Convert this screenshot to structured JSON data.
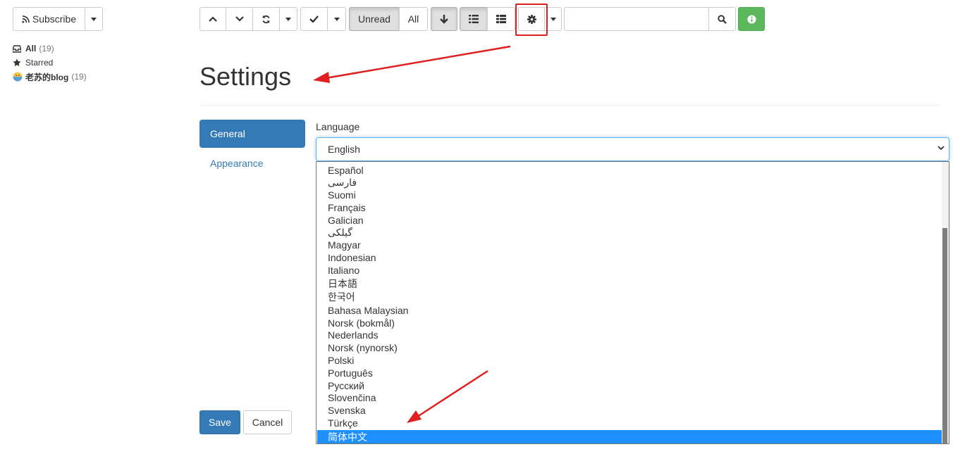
{
  "toolbar": {
    "subscribe_label": "Subscribe",
    "unread_label": "Unread",
    "all_label": "All",
    "search_value": "",
    "search_placeholder": ""
  },
  "sidebar": {
    "items": [
      {
        "label": "All",
        "count": "(19)",
        "icon": "inbox-icon"
      },
      {
        "label": "Starred",
        "count": "",
        "icon": "star-icon"
      },
      {
        "label": "老苏的blog",
        "count": "(19)",
        "icon": "feed-avatar-icon"
      }
    ]
  },
  "settings": {
    "title": "Settings",
    "nav": {
      "general": "General",
      "appearance": "Appearance"
    },
    "language_label": "Language",
    "language_value": "English",
    "options": [
      "Español",
      "فارسی",
      "Suomi",
      "Français",
      "Galician",
      "گیلکی",
      "Magyar",
      "Indonesian",
      "Italiano",
      "日本語",
      "한국어",
      "Bahasa Malaysian",
      "Norsk (bokmål)",
      "Nederlands",
      "Norsk (nynorsk)",
      "Polski",
      "Português",
      "Русский",
      "Slovenčina",
      "Svenska",
      "Türkçe",
      "简体中文"
    ],
    "selected_option": "简体中文",
    "save_label": "Save",
    "cancel_label": "Cancel"
  },
  "colors": {
    "primary": "#337ab7",
    "success": "#5cb85c",
    "annotation": "#e02020",
    "selected": "#1e90ff"
  }
}
